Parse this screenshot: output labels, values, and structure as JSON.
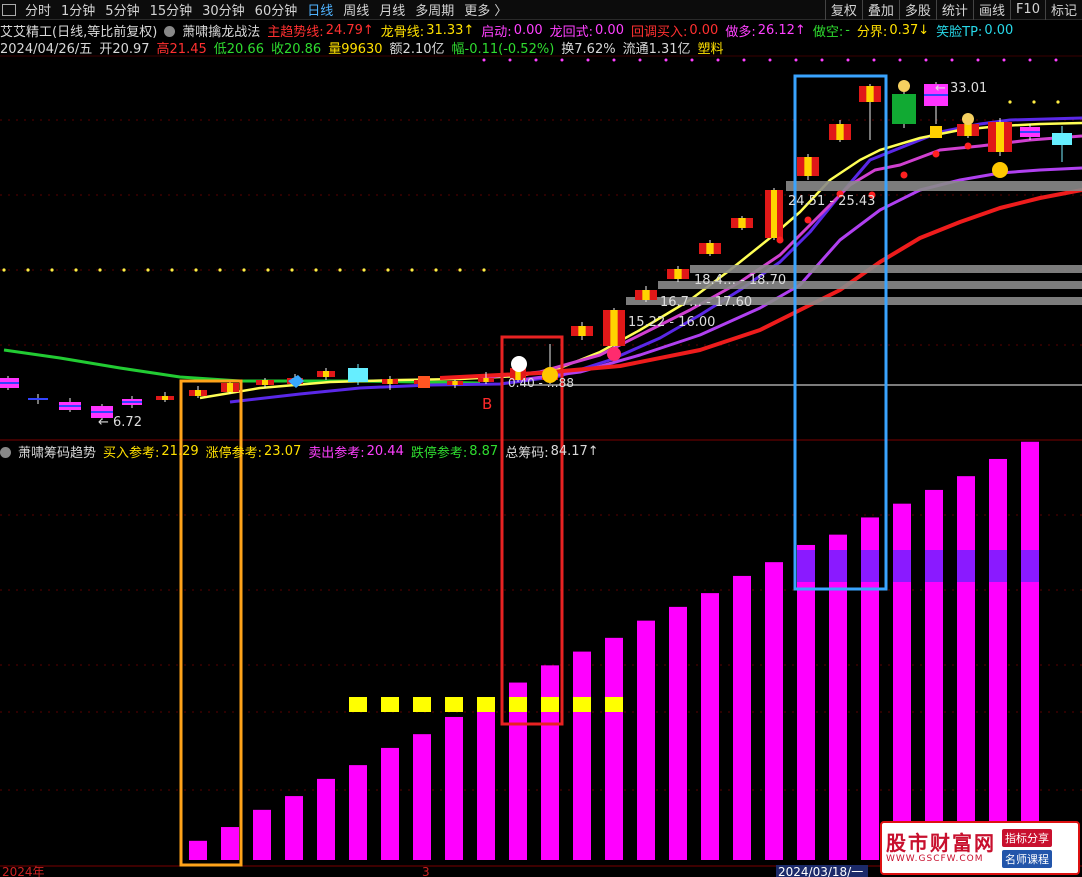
{
  "toolbar": {
    "tabs": [
      {
        "label": "分时",
        "active": false
      },
      {
        "label": "1分钟",
        "active": false
      },
      {
        "label": "5分钟",
        "active": false
      },
      {
        "label": "15分钟",
        "active": false
      },
      {
        "label": "30分钟",
        "active": false
      },
      {
        "label": "60分钟",
        "active": false
      },
      {
        "label": "日线",
        "active": true
      },
      {
        "label": "周线",
        "active": false
      },
      {
        "label": "月线",
        "active": false
      },
      {
        "label": "多周期",
        "active": false
      },
      {
        "label": "更多 〉",
        "active": false
      }
    ],
    "right_buttons": [
      "复权",
      "叠加",
      "多股",
      "统计",
      "画线",
      "F10",
      "标记"
    ]
  },
  "price_header": {
    "stock": "艾艾精工(日线,等比前复权)",
    "indicator": "萧啸擒龙战法",
    "fields": [
      {
        "label": "主趋势线:",
        "value": "24.79↑",
        "color": "#ff3030"
      },
      {
        "label": "龙骨线:",
        "value": "31.33↑",
        "color": "#ffe000"
      },
      {
        "label": "启动:",
        "value": "0.00",
        "color": "#ff40ff"
      },
      {
        "label": "龙回式:",
        "value": "0.00",
        "color": "#ff40ff"
      },
      {
        "label": "回调买入:",
        "value": "0.00",
        "color": "#ff3030"
      },
      {
        "label": "做多:",
        "value": "26.12↑",
        "color": "#ff40ff"
      },
      {
        "label": "做空:",
        "value": "-",
        "color": "#2fdc2f"
      },
      {
        "label": "分界:",
        "value": "0.37↓",
        "color": "#ffe000"
      },
      {
        "label": "笑脸TP:",
        "value": "0.00",
        "color": "#28d8e8"
      }
    ]
  },
  "quote_line": {
    "date": "2024/04/26/五",
    "open": "开20.97",
    "high": "高21.45",
    "low": "低20.66",
    "close": "收20.86",
    "volume": "量99630",
    "amount": "额2.10亿",
    "amplitude": "幅-0.11(-0.52%)",
    "turnover": "换7.62%",
    "float": "流通1.31亿",
    "sector": "塑料"
  },
  "chip_header": {
    "title": "萧啸筹码趋势",
    "fields": [
      {
        "label": "买入参考:",
        "value": "21.29",
        "color": "#ffe000"
      },
      {
        "label": "涨停参考:",
        "value": "23.07",
        "color": "#ffe000"
      },
      {
        "label": "卖出参考:",
        "value": "20.44",
        "color": "#ff40ff"
      },
      {
        "label": "跌停参考:",
        "value": "8.87",
        "color": "#2fdc2f"
      },
      {
        "label": "总筹码:",
        "value": "84.17↑",
        "color": "#d8d8d8"
      }
    ]
  },
  "price_labels": [
    "← 6.72",
    "15.22 - 16.00",
    "16.7… - 17.60",
    "18.4… - 18.70",
    "24.51 - 25.43",
    "← 33.01",
    "0.40 - …88",
    "B"
  ],
  "date_axis": [
    "2024年",
    "3",
    "2024/03/18/一"
  ],
  "watermark": {
    "site": "股市财富网",
    "url": "WWW.GSCFW.COM",
    "tag1": "指标分享",
    "tag2": "名师课程"
  },
  "chip_bars": {
    "values": [
      5,
      9,
      14,
      18,
      23,
      27,
      32,
      36,
      41,
      46,
      51,
      56,
      60,
      64,
      69,
      73,
      77,
      82,
      86,
      91,
      94,
      99,
      103,
      107,
      111,
      116,
      121
    ],
    "yellow_band": [
      5,
      13
    ],
    "purple_band": [
      19,
      26
    ]
  },
  "colors": {
    "bar": "#ff00ff",
    "yellow": "#ffff00",
    "purple": "#8a1aff",
    "bg": "#000000"
  }
}
